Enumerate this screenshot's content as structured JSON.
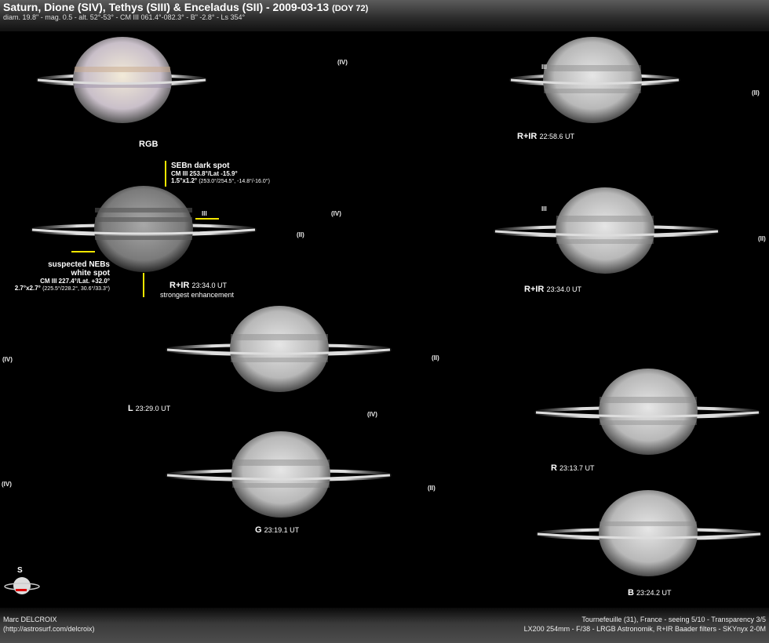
{
  "header": {
    "title": "Saturn, Dione (SIV), Tethys (SIII) & Enceladus (SII) - 2009-03-13",
    "doy": "(DOY 72)",
    "subtitle": "diam. 19.8\" - mag. 0.5 - alt. 52°-53° - CM III 061.4°-082.3° - B\" -2.8° - Ls 354°"
  },
  "colors": {
    "highlight_lines": "#f3e600",
    "background": "#000000"
  },
  "images": [
    {
      "name": "rgb",
      "label": "RGB",
      "time": ""
    },
    {
      "name": "rir-2258",
      "label": "R+IR",
      "time": "22:58.6 UT"
    },
    {
      "name": "rir-2334-left",
      "label": "R+IR",
      "time": "23:34.0 UT",
      "extra": "strongest enhancement"
    },
    {
      "name": "rir-2334-right",
      "label": "R+IR",
      "time": "23:34.0 UT"
    },
    {
      "name": "l",
      "label": "L",
      "time": "23:29.0 UT"
    },
    {
      "name": "r",
      "label": "R",
      "time": "23:13.7 UT"
    },
    {
      "name": "g",
      "label": "G",
      "time": "23:19.1 UT"
    },
    {
      "name": "b",
      "label": "B",
      "time": "23:24.2 UT"
    }
  ],
  "moons": {
    "dione": "(IV)",
    "tethys": "III",
    "enceladus": "(II)"
  },
  "annotations": {
    "seb": {
      "title": "SEBn dark spot",
      "line2": "CM III 253.8°/Lat -15.9°",
      "line3": "1.5°x1.2°",
      "line3_small": "(253.0°/254.5°, -14.8°/-16.0°)"
    },
    "neb": {
      "title1": "suspected NEBs",
      "title2": "white spot",
      "line3": "CM III 227.4°/Lat. +32.0°",
      "line4": "2.7°x2.7°",
      "line4_small": "(225.5°/228.2°, 30.6°/33.3°)"
    }
  },
  "compass": {
    "south": "S"
  },
  "footer": {
    "author": "Marc DELCROIX",
    "url": "(http://astrosurf.com/delcroix)",
    "site": "Tournefeuille (31), France - seeing 5/10 - Transparency 3/5",
    "equipment": "LX200 254mm - F/38 - LRGB Astronomik, R+IR Baader filters - SKYnyx 2-0M"
  }
}
